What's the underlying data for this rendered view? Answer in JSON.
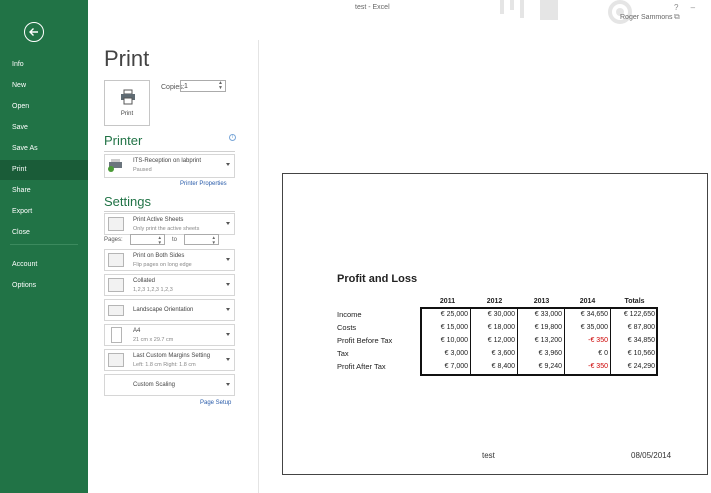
{
  "window": {
    "title": "test - Excel",
    "user": "Roger Sammons",
    "controls": "? – ⧉"
  },
  "nav": {
    "items": [
      {
        "label": "Info"
      },
      {
        "label": "New"
      },
      {
        "label": "Open"
      },
      {
        "label": "Save"
      },
      {
        "label": "Save As"
      },
      {
        "label": "Print"
      },
      {
        "label": "Share"
      },
      {
        "label": "Export"
      },
      {
        "label": "Close"
      },
      {
        "label": "Account"
      },
      {
        "label": "Options"
      }
    ],
    "active": "Print",
    "accent_color": "#217346"
  },
  "print": {
    "page_title": "Print",
    "print_button_label": "Print",
    "copies_label": "Copies:",
    "copies_value": "1",
    "printer_heading": "Printer",
    "printer_name": "ITS-Reception on labprint",
    "printer_status": "Paused",
    "printer_properties_link": "Printer Properties",
    "settings_heading": "Settings",
    "what_to_print": {
      "title": "Print Active Sheets",
      "sub": "Only print the active sheets"
    },
    "pages_label": "Pages:",
    "to_label": "to",
    "sides": {
      "title": "Print on Both Sides",
      "sub": "Flip pages on long edge"
    },
    "collation": {
      "title": "Collated",
      "sub": "1,2,3   1,2,3   1,2,3"
    },
    "orientation": {
      "title": "Landscape Orientation"
    },
    "paper": {
      "title": "A4",
      "sub": "21 cm x 29.7 cm"
    },
    "margins": {
      "title": "Last Custom Margins Setting",
      "sub": "Left: 1.8 cm   Right: 1.8 cm"
    },
    "scaling": {
      "title": "Custom Scaling"
    },
    "page_setup_link": "Page Setup"
  },
  "preview": {
    "title": "Profit and Loss",
    "headers": [
      "2011",
      "2012",
      "2013",
      "2014",
      "Totals"
    ],
    "rows": [
      {
        "label": "Income",
        "values": [
          "€ 25,000",
          "€ 30,000",
          "€ 33,000",
          "€ 34,650",
          "€ 122,650"
        ],
        "neg": [
          false,
          false,
          false,
          false,
          false
        ]
      },
      {
        "label": "Costs",
        "values": [
          "€ 15,000",
          "€ 18,000",
          "€ 19,800",
          "€ 35,000",
          "€ 87,800"
        ],
        "neg": [
          false,
          false,
          false,
          false,
          false
        ]
      },
      {
        "label": "Profit Before Tax",
        "values": [
          "€ 10,000",
          "€ 12,000",
          "€ 13,200",
          "-€ 350",
          "€ 34,850"
        ],
        "neg": [
          false,
          false,
          false,
          true,
          false
        ]
      },
      {
        "label": "Tax",
        "values": [
          "€ 3,000",
          "€ 3,600",
          "€ 3,960",
          "€ 0",
          "€ 10,560"
        ],
        "neg": [
          false,
          false,
          false,
          false,
          false
        ]
      },
      {
        "label": "Profit After Tax",
        "values": [
          "€ 7,000",
          "€ 8,400",
          "€ 9,240",
          "-€ 350",
          "€ 24,290"
        ],
        "neg": [
          false,
          false,
          false,
          true,
          false
        ]
      }
    ],
    "footer_left": "test",
    "footer_right": "08/05/2014",
    "negative_color": "#cc0000"
  }
}
